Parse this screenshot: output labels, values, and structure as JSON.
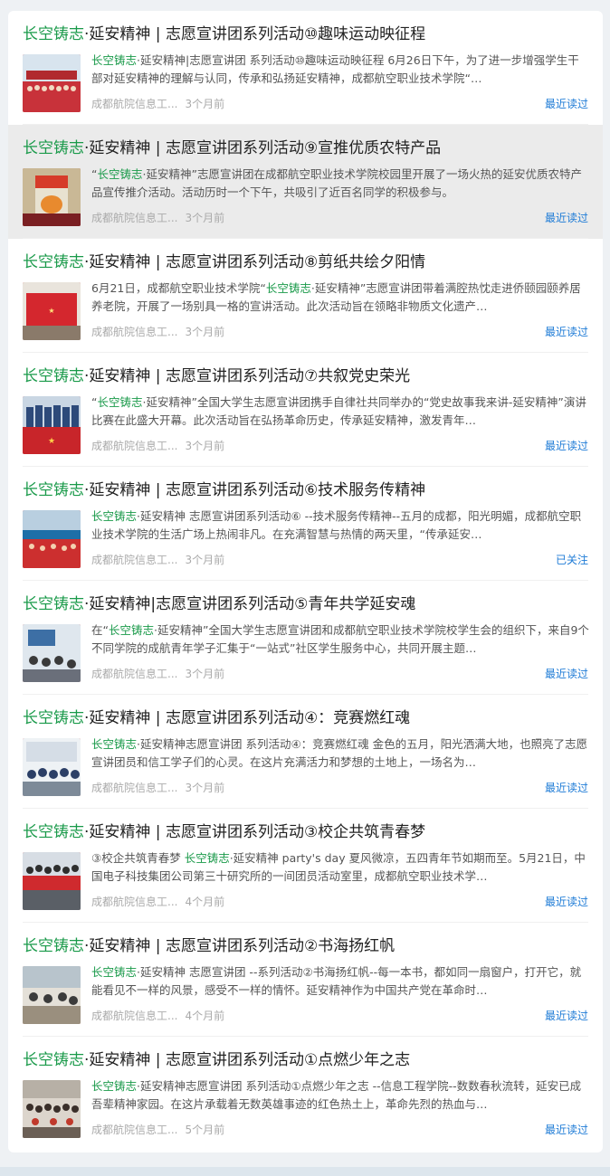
{
  "colors": {
    "keyword": "#1a9a4a",
    "action": "#1e7bd6",
    "highlight_row": "#ebebeb"
  },
  "articles": [
    {
      "kw": "长空铸志",
      "title_rest": "·延安精神 | 志愿宣讲团系列活动⑩趣味运动映征程",
      "summary_pre": "",
      "summary_kw": "长空铸志",
      "summary_post": "·延安精神|志愿宣讲团 系列活动⑩趣味运动映征程 6月26日下午，为了进一步增强学生干部对延安精神的理解与认同，传承和弘扬延安精神，成都航空职业技术学院“…",
      "source": "成都航院信息工...",
      "time": "3个月前",
      "action": "最近读过",
      "thumb": "thumbnail-group-photo"
    },
    {
      "kw": "长空铸志",
      "title_rest": "·延安精神 | 志愿宣讲团系列活动⑨宣推优质农特产品",
      "summary_pre": "“",
      "summary_kw": "长空铸志",
      "summary_post": "·延安精神”志愿宣讲团在成都航空职业技术学院校园里开展了一场火热的延安优质农特产品宣传推介活动。活动历时一个下午，共吸引了近百名同学的积极参与。",
      "source": "成都航院信息工...",
      "time": "3个月前",
      "action": "最近读过",
      "thumb": "thumbnail-product"
    },
    {
      "kw": "长空铸志",
      "title_rest": "·延安精神 | 志愿宣讲团系列活动⑧剪纸共绘夕阳情",
      "summary_pre": "6月21日，成都航空职业技术学院“",
      "summary_kw": "长空铸志",
      "summary_post": "·延安精神”志愿宣讲团带着满腔热忱走进侨颐园颐养居养老院，开展了一场别具一格的宣讲活动。此次活动旨在领略非物质文化遗产…",
      "source": "成都航院信息工...",
      "time": "3个月前",
      "action": "最近读过",
      "thumb": "thumbnail-banner"
    },
    {
      "kw": "长空铸志",
      "title_rest": "·延安精神 | 志愿宣讲团系列活动⑦共叙党史荣光",
      "summary_pre": "“",
      "summary_kw": "长空铸志",
      "summary_post": "·延安精神”全国大学生志愿宣讲团携手自律社共同举办的“党史故事我来讲-延安精神”演讲比赛在此盛大开幕。此次活动旨在弘扬革命历史，传承延安精神，激发青年…",
      "source": "成都航院信息工...",
      "time": "3个月前",
      "action": "最近读过",
      "thumb": "thumbnail-stage"
    },
    {
      "kw": "长空铸志",
      "title_rest": "·延安精神 | 志愿宣讲团系列活动⑥技术服务传精神",
      "summary_pre": "",
      "summary_kw": "长空铸志",
      "summary_post": "·延安精神 志愿宣讲团系列活动⑥ --技术服务传精神--五月的成都，阳光明媚，成都航空职业技术学院的生活广场上热闹非凡。在充满智慧与热情的两天里，“传承延安…",
      "source": "成都航院信息工...",
      "time": "3个月前",
      "action": "已关注",
      "thumb": "thumbnail-outdoor"
    },
    {
      "kw": "长空铸志",
      "title_rest": "·延安精神|志愿宣讲团系列活动⑤青年共学延安魂",
      "summary_pre": "在“",
      "summary_kw": "长空铸志",
      "summary_post": "·延安精神”全国大学生志愿宣讲团和成都航空职业技术学院校学生会的组织下，来自9个不同学院的成航青年学子汇集于“一站式”社区学生服务中心，共同开展主题…",
      "source": "成都航院信息工...",
      "time": "3个月前",
      "action": "最近读过",
      "thumb": "thumbnail-classroom"
    },
    {
      "kw": "长空铸志",
      "title_rest": "·延安精神 | 志愿宣讲团系列活动④：竞赛燃红魂",
      "summary_pre": "",
      "summary_kw": "长空铸志",
      "summary_post": "·延安精神志愿宣讲团 系列活动④：竞赛燃红魂 金色的五月，阳光洒满大地，也照亮了志愿宣讲团员和信工学子们的心灵。在这片充满活力和梦想的土地上，一场名为…",
      "source": "成都航院信息工...",
      "time": "3个月前",
      "action": "最近读过",
      "thumb": "thumbnail-meeting"
    },
    {
      "kw": "长空铸志",
      "title_rest": "·延安精神 | 志愿宣讲团系列活动③校企共筑青春梦",
      "summary_pre": "③校企共筑青春梦 ",
      "summary_kw": "长空铸志",
      "summary_post": "·延安精神 party's day 夏风微凉，五四青年节如期而至。5月21日，中国电子科技集团公司第三十研究所的一间团员活动室里，成都航空职业技术学…",
      "source": "成都航院信息工...",
      "time": "4个月前",
      "action": "最近读过",
      "thumb": "thumbnail-group-banner"
    },
    {
      "kw": "长空铸志",
      "title_rest": "·延安精神 | 志愿宣讲团系列活动②书海扬红帆",
      "summary_pre": "",
      "summary_kw": "长空铸志",
      "summary_post": "·延安精神 志愿宣讲团 --系列活动②书海扬红帆--每一本书，都如同一扇窗户，打开它，就能看见不一样的风景，感受不一样的情怀。延安精神作为中国共产党在革命时…",
      "source": "成都航院信息工...",
      "time": "4个月前",
      "action": "最近读过",
      "thumb": "thumbnail-library"
    },
    {
      "kw": "长空铸志",
      "title_rest": "·延安精神 | 志愿宣讲团系列活动①点燃少年之志",
      "summary_pre": "",
      "summary_kw": "长空铸志",
      "summary_post": "·延安精神志愿宣讲团 系列活动①点燃少年之志 --信息工程学院--数数春秋流转，延安已成吾辈精神家园。在这片承载着无数英雄事迹的红色热土上，革命先烈的热血与…",
      "source": "成都航院信息工...",
      "time": "5个月前",
      "action": "最近读过",
      "thumb": "thumbnail-audience"
    }
  ]
}
